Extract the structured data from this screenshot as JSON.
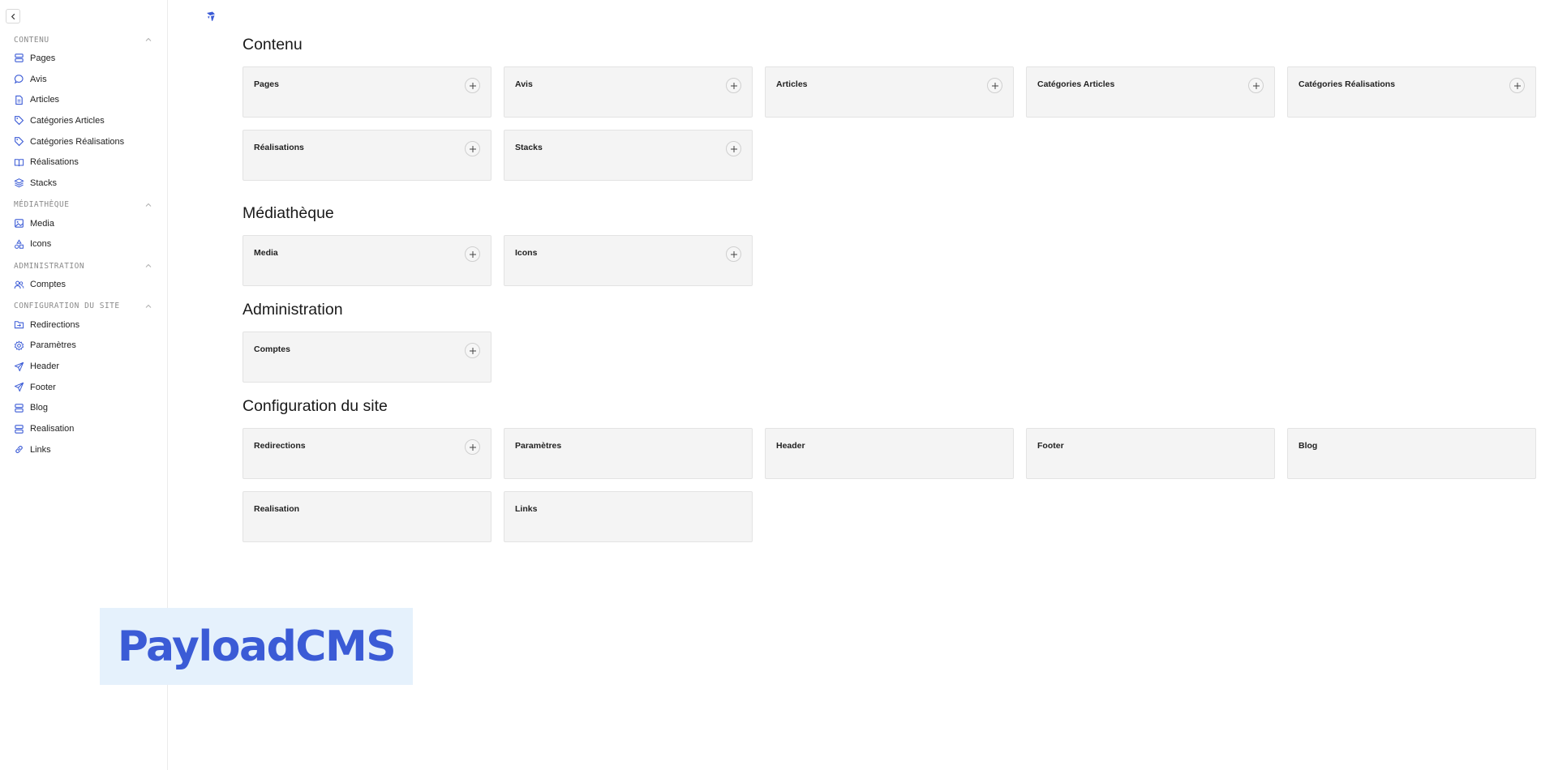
{
  "sidebar": {
    "groups": [
      {
        "title": "Contenu",
        "items": [
          {
            "label": "Pages",
            "icon": "database-icon"
          },
          {
            "label": "Avis",
            "icon": "chat-bubble-icon"
          },
          {
            "label": "Articles",
            "icon": "document-icon"
          },
          {
            "label": "Catégories Articles",
            "icon": "tag-icon"
          },
          {
            "label": "Catégories Réalisations",
            "icon": "tag-icon"
          },
          {
            "label": "Réalisations",
            "icon": "book-open-icon"
          },
          {
            "label": "Stacks",
            "icon": "layers-icon"
          }
        ]
      },
      {
        "title": "Médiathèque",
        "items": [
          {
            "label": "Media",
            "icon": "image-icon"
          },
          {
            "label": "Icons",
            "icon": "shapes-icon"
          }
        ]
      },
      {
        "title": "Administration",
        "items": [
          {
            "label": "Comptes",
            "icon": "users-icon"
          }
        ]
      },
      {
        "title": "Configuration du site",
        "items": [
          {
            "label": "Redirections",
            "icon": "folder-arrow-icon"
          },
          {
            "label": "Paramètres",
            "icon": "gear-icon"
          },
          {
            "label": "Header",
            "icon": "send-icon"
          },
          {
            "label": "Footer",
            "icon": "send-icon"
          },
          {
            "label": "Blog",
            "icon": "database-icon"
          },
          {
            "label": "Realisation",
            "icon": "database-icon"
          },
          {
            "label": "Links",
            "icon": "link-icon"
          }
        ]
      }
    ]
  },
  "main": {
    "sections": [
      {
        "title": "Contenu",
        "cards": [
          {
            "label": "Pages",
            "add": true
          },
          {
            "label": "Avis",
            "add": true
          },
          {
            "label": "Articles",
            "add": true
          },
          {
            "label": "Catégories Articles",
            "add": true
          },
          {
            "label": "Catégories Réalisations",
            "add": true
          },
          {
            "label": "Réalisations",
            "add": true
          },
          {
            "label": "Stacks",
            "add": true
          }
        ]
      },
      {
        "title": "Médiathèque",
        "cards": [
          {
            "label": "Media",
            "add": true
          },
          {
            "label": "Icons",
            "add": true
          }
        ]
      },
      {
        "title": "Administration",
        "cards": [
          {
            "label": "Comptes",
            "add": true
          }
        ]
      },
      {
        "title": "Configuration du site",
        "cards": [
          {
            "label": "Redirections",
            "add": true
          },
          {
            "label": "Paramètres",
            "add": false
          },
          {
            "label": "Header",
            "add": false
          },
          {
            "label": "Footer",
            "add": false
          },
          {
            "label": "Blog",
            "add": false
          },
          {
            "label": "Realisation",
            "add": false
          },
          {
            "label": "Links",
            "add": false
          }
        ]
      }
    ]
  },
  "watermark": {
    "text": "PayloadCMS"
  },
  "colors": {
    "accent": "#3b5bd6",
    "card_bg": "#f4f4f4",
    "watermark_bg": "#e5f1fc"
  }
}
